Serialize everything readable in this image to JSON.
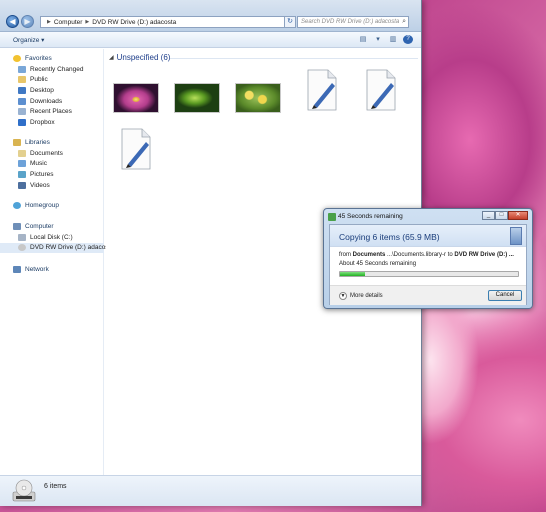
{
  "explorer": {
    "address": {
      "crumbs": [
        "Computer",
        "DVD RW Drive (D:) adacosta"
      ]
    },
    "search_placeholder": "Search DVD RW Drive (D:) adacosta",
    "toolbar": {
      "organize_label": "Organize ▾"
    },
    "nav": {
      "favorites": {
        "label": "Favorites",
        "items": [
          "Recently Changed",
          "Public",
          "Desktop",
          "Downloads",
          "Recent Places",
          "Dropbox"
        ]
      },
      "libraries": {
        "label": "Libraries",
        "items": [
          "Documents",
          "Music",
          "Pictures",
          "Videos"
        ]
      },
      "homegroup": {
        "label": "Homegroup"
      },
      "computer": {
        "label": "Computer",
        "items": [
          "Local Disk (C:)",
          "DVD RW Drive (D:) adacosta"
        ]
      },
      "network": {
        "label": "Network"
      }
    },
    "content": {
      "group_header": "Unspecified (6)",
      "files": [
        {
          "type": "image",
          "theme": "lotus"
        },
        {
          "type": "image",
          "theme": "green-leaf"
        },
        {
          "type": "image",
          "theme": "flowers"
        },
        {
          "type": "document"
        },
        {
          "type": "document"
        },
        {
          "type": "document"
        }
      ]
    },
    "status": {
      "item_count": "6 items"
    }
  },
  "dialog": {
    "title": "45 Seconds remaining",
    "heading": "Copying 6 items (65.9 MB)",
    "from_prefix": "from ",
    "from_source": "Documents",
    "from_path": " ...\\Documents.library-r to ",
    "to_dest": "DVD RW Drive (D:) ...",
    "remaining": "About 45 Seconds remaining",
    "progress_percent": 14,
    "more_details": "More details",
    "cancel_label": "Cancel"
  },
  "colors": {
    "progress_fill": "#22b122",
    "group_header": "#1e3e8a"
  }
}
